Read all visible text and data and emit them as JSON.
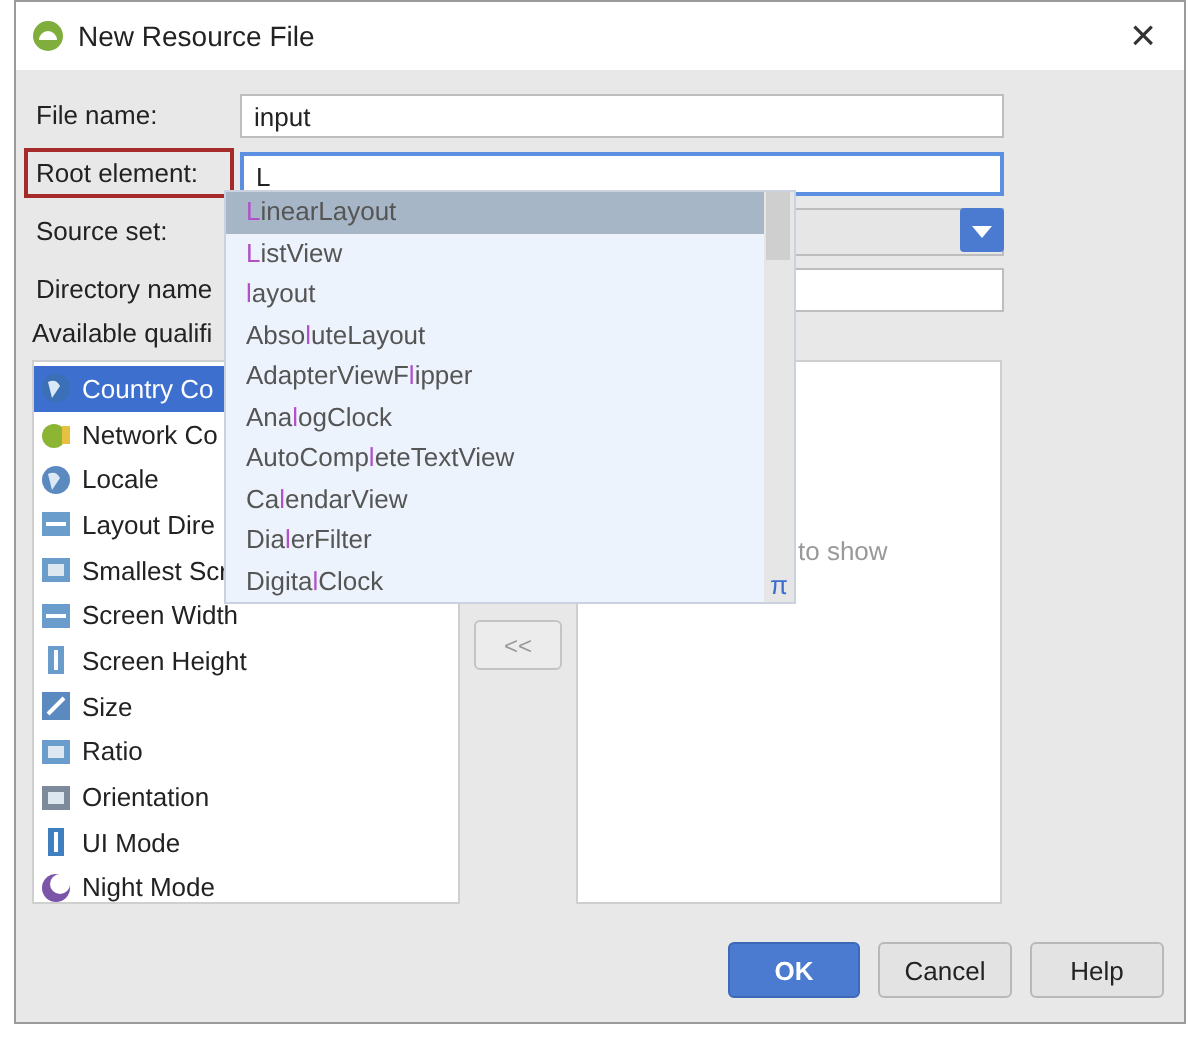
{
  "window": {
    "title": "New Resource File",
    "close": "×"
  },
  "form": [
    {
      "kind": "text",
      "label": "File name:",
      "value": "input",
      "focused": false,
      "highlighted": false
    },
    {
      "kind": "text",
      "label": "Root element:",
      "value": "L",
      "focused": true,
      "highlighted": true
    },
    {
      "kind": "dropdown",
      "label": "Source set:",
      "focused": false,
      "highlighted": false
    },
    {
      "kind": "text",
      "label": "Directory name",
      "focused": false,
      "highlighted": false
    }
  ],
  "qualifiers_label": "Available qualifi",
  "qualifiers": [
    {
      "label": "Country Co",
      "selected": true
    },
    {
      "label": "Network Co",
      "selected": false
    },
    {
      "label": "Locale",
      "selected": false
    },
    {
      "label": "Layout Dire",
      "selected": false
    },
    {
      "label": "Smallest Scr",
      "selected": false
    },
    {
      "label": "Screen Width",
      "selected": false
    },
    {
      "label": "Screen Height",
      "selected": false
    },
    {
      "label": "Size",
      "selected": false
    },
    {
      "label": "Ratio",
      "selected": false
    },
    {
      "label": "Orientation",
      "selected": false
    },
    {
      "label": "UI Mode",
      "selected": false
    },
    {
      "label": "Night Mode",
      "selected": false
    }
  ],
  "remove_button": "<<",
  "chosen_empty_text": "to show",
  "completion": {
    "items": [
      {
        "match": "L",
        "post": "inearLayout",
        "selected": true
      },
      {
        "match": "L",
        "post": "istView",
        "selected": false
      },
      {
        "match": "l",
        "post": "ayout",
        "selected": false
      },
      {
        "pre": "Abso",
        "match": "l",
        "post": "uteLayout",
        "selected": false
      },
      {
        "pre": "AdapterViewF",
        "match": "l",
        "post": "ipper",
        "selected": false
      },
      {
        "pre": "Ana",
        "match": "l",
        "post": "ogClock",
        "selected": false
      },
      {
        "pre": "AutoComp",
        "match": "l",
        "post": "eteTextView",
        "selected": false
      },
      {
        "pre": "Ca",
        "match": "l",
        "post": "endarView",
        "selected": false
      },
      {
        "pre": "Dia",
        "match": "l",
        "post": "erFilter",
        "selected": false
      },
      {
        "pre": "Digita",
        "match": "l",
        "post": "Clock",
        "selected": false
      }
    ],
    "corner": "π"
  },
  "buttons": [
    {
      "label": "OK",
      "kind": "primary"
    },
    {
      "label": "Cancel",
      "kind": "normal"
    },
    {
      "label": "Help",
      "kind": "normal"
    }
  ]
}
